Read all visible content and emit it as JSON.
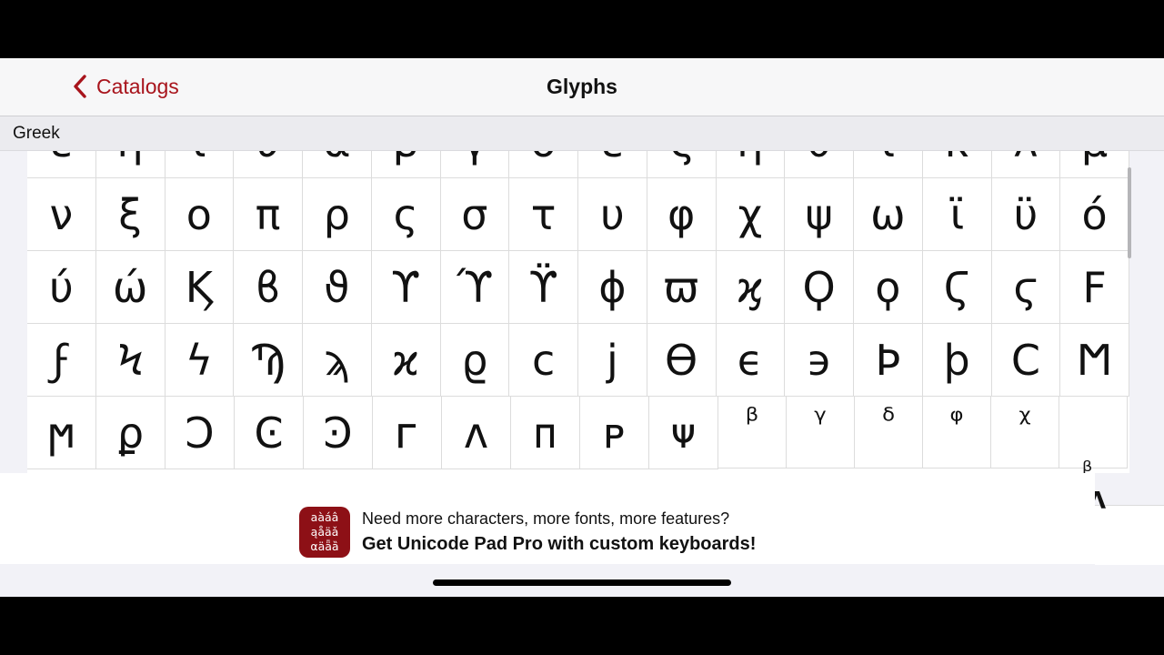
{
  "navbar": {
    "back_label": "Catalogs",
    "title": "Glyphs",
    "accent_color": "#a8141c"
  },
  "section": {
    "label": "Greek"
  },
  "glyph_rows": [
    [
      "ε",
      "η",
      "ι",
      "υ",
      "α",
      "β",
      "γ",
      "δ",
      "ε",
      "ζ",
      "η",
      "θ",
      "ι",
      "κ",
      "λ",
      "μ"
    ],
    [
      "ν",
      "ξ",
      "ο",
      "π",
      "ρ",
      "ς",
      "σ",
      "τ",
      "υ",
      "φ",
      "χ",
      "ψ",
      "ω",
      "ϊ",
      "ϋ",
      "ό"
    ],
    [
      "ύ",
      "ώ",
      "Ϗ",
      "ϐ",
      "ϑ",
      "ϒ",
      "ϓ",
      "ϔ",
      "ϕ",
      "ϖ",
      "ϗ",
      "Ϙ",
      "ϙ",
      "Ϛ",
      "ϛ",
      "Ϝ"
    ],
    [
      "ϝ",
      "Ϟ",
      "ϟ",
      "Ϡ",
      "ϡ",
      "ϰ",
      "ϱ",
      "ϲ",
      "ϳ",
      "ϴ",
      "ϵ",
      "϶",
      "Ϸ",
      "ϸ",
      "Ϲ",
      "Ϻ"
    ],
    [
      "ϻ",
      "ϼ",
      "Ͻ",
      "Ͼ",
      "Ͽ",
      "ᴦ",
      "ᴧ",
      "ᴨ",
      "ᴩ",
      "ᴪ",
      "ᵝ",
      "ᵞ",
      "ᵟ",
      "ᵠ",
      "ᵡ",
      ""
    ]
  ],
  "peek_glyphs": [
    "ᵦ",
    "Λ"
  ],
  "banner": {
    "icon_lines": [
      "aàáâ",
      "ąåäǎ",
      "αäǟȁ"
    ],
    "line1": "Need more characters, more fonts, more features?",
    "line2": "Get Unicode Pad Pro with custom keyboards!",
    "icon_color": "#8d1016"
  }
}
